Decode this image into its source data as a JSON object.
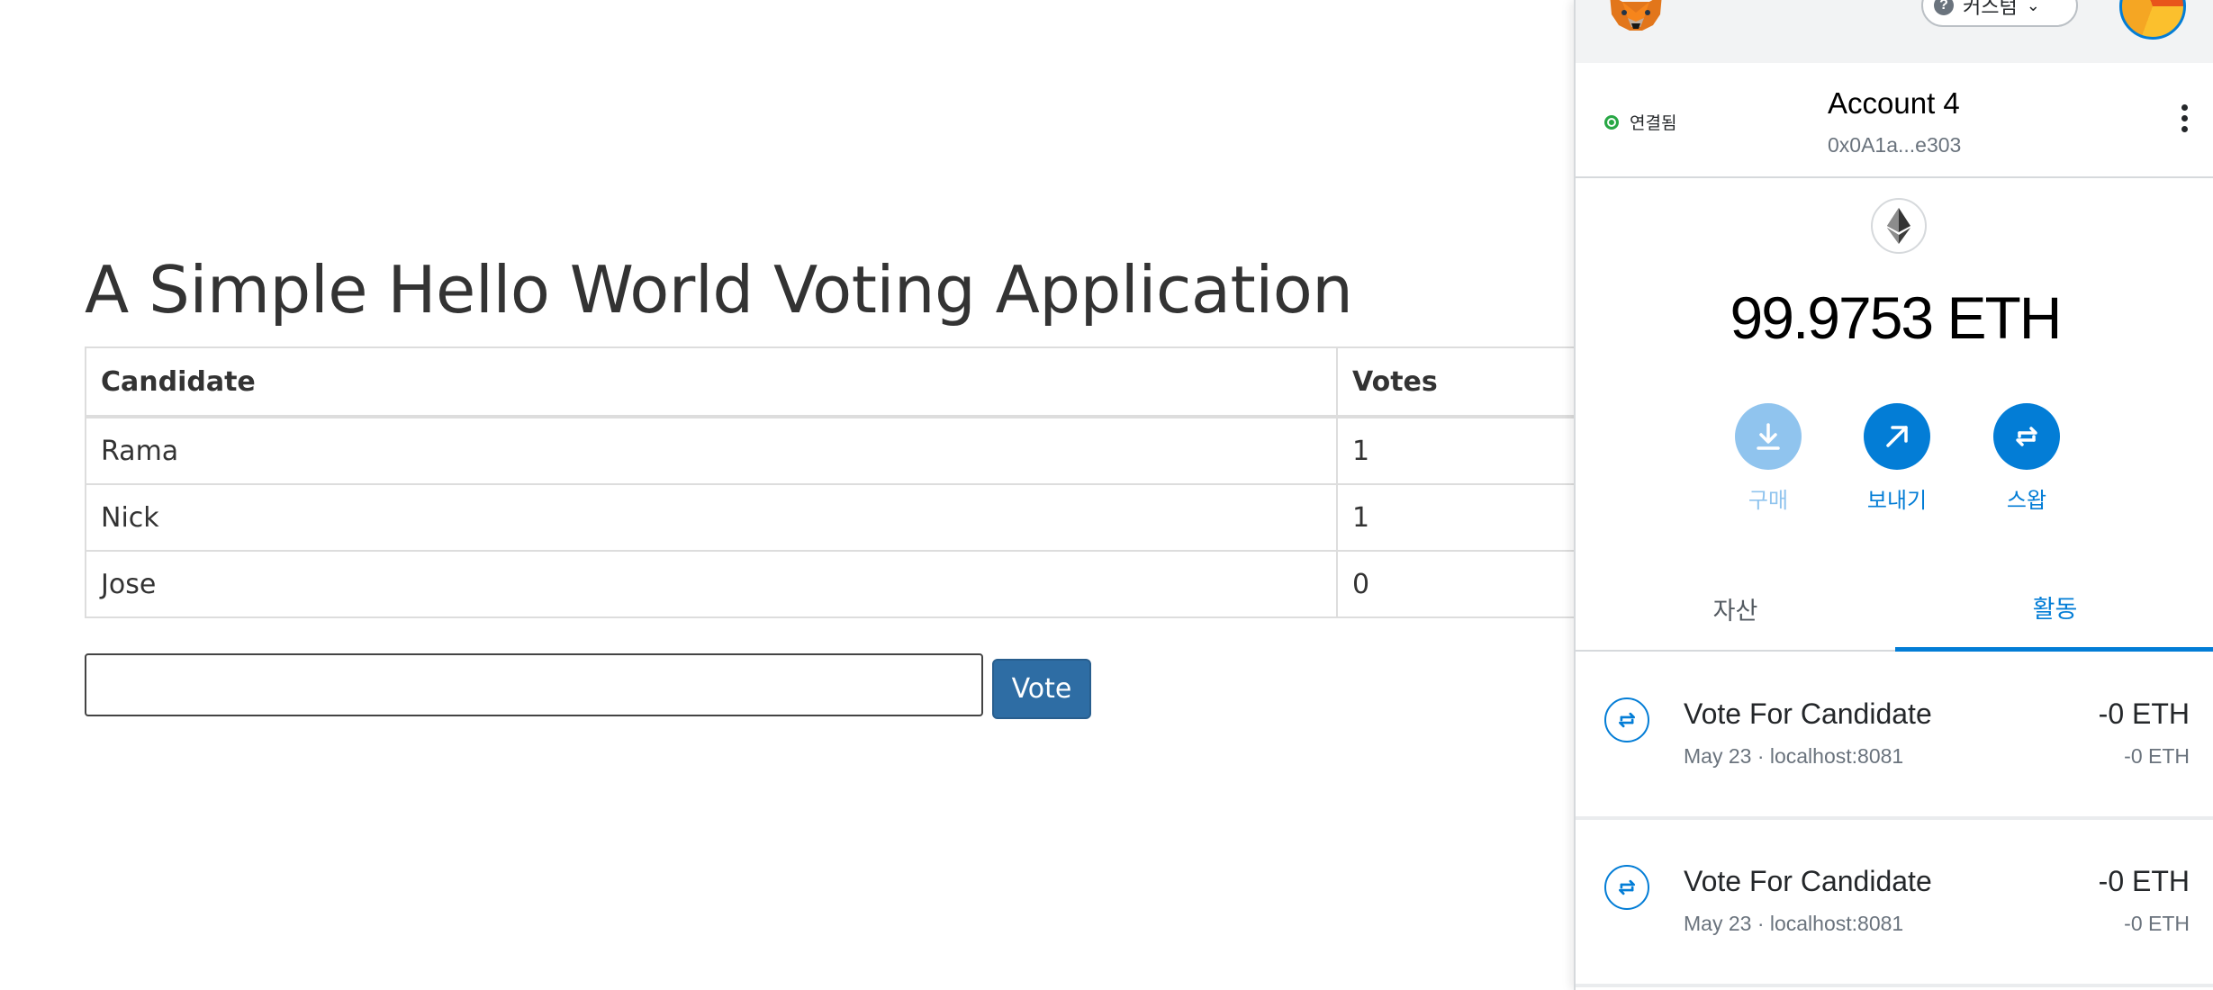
{
  "voting_app": {
    "title": "A Simple Hello World Voting Application",
    "table": {
      "headers": [
        "Candidate",
        "Votes"
      ],
      "rows": [
        {
          "name": "Rama",
          "votes": "1"
        },
        {
          "name": "Nick",
          "votes": "1"
        },
        {
          "name": "Jose",
          "votes": "0"
        }
      ]
    },
    "candidate_input": {
      "value": "",
      "placeholder": ""
    },
    "vote_button_label": "Vote"
  },
  "metamask": {
    "network_label": "커스텀",
    "connection_status": "연결됨",
    "account_name": "Account 4",
    "account_address": "0x0A1a...e303",
    "balance": "99.9753 ETH",
    "actions": [
      {
        "label": "구매",
        "icon": "download-icon"
      },
      {
        "label": "보내기",
        "icon": "arrow-up-right-icon"
      },
      {
        "label": "스왑",
        "icon": "swap-icon"
      }
    ],
    "tabs": [
      {
        "label": "자산",
        "active": false
      },
      {
        "label": "활동",
        "active": true
      }
    ],
    "transactions": [
      {
        "title": "Vote For Candidate",
        "meta": "May 23 · localhost:8081",
        "amount": "-0 ETH",
        "secondary_amount": "-0 ETH",
        "icon": "swap-icon"
      },
      {
        "title": "Vote For Candidate",
        "meta": "May 23 · localhost:8081",
        "amount": "-0 ETH",
        "secondary_amount": "-0 ETH",
        "icon": "swap-icon"
      }
    ],
    "colors": {
      "primary": "#037dd6",
      "primary_disabled": "#90c4ee",
      "connected": "#28a745"
    }
  }
}
